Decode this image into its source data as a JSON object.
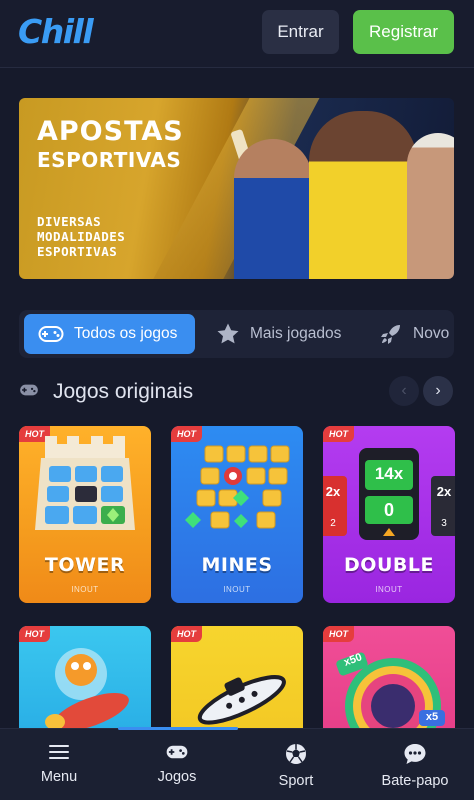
{
  "header": {
    "logo": "Chill",
    "login_label": "Entrar",
    "register_label": "Registrar"
  },
  "banner": {
    "title_line1": "APOSTAS",
    "title_line2": "ESPORTIVAS",
    "subtitle": "DIVERSAS MODALIDADES ESPORTIVAS"
  },
  "tabs": [
    {
      "label": "Todos os jogos",
      "icon": "gamepad-icon",
      "active": true
    },
    {
      "label": "Mais jogados",
      "icon": "star-icon",
      "active": false
    },
    {
      "label": "Novo",
      "icon": "rocket-icon",
      "active": false
    }
  ],
  "section": {
    "title": "Jogos originais",
    "icon": "gamepad-icon"
  },
  "games": [
    {
      "name": "TOWER",
      "provider": "INOUT",
      "badge": "HOT"
    },
    {
      "name": "MINES",
      "provider": "INOUT",
      "badge": "HOT"
    },
    {
      "name": "DOUBLE",
      "provider": "INOUT",
      "badge": "HOT"
    },
    {
      "name": "",
      "provider": "",
      "badge": "HOT"
    },
    {
      "name": "",
      "provider": "",
      "badge": "HOT"
    },
    {
      "name": "",
      "provider": "",
      "badge": "HOT"
    }
  ],
  "double_art": {
    "center": "14x",
    "center_value": "0",
    "left": "2x",
    "left_value": "2",
    "right": "2x",
    "right_value": "3"
  },
  "card6_art": {
    "top": "x50",
    "bottom": "x5"
  },
  "bottom_nav": [
    {
      "label": "Menu",
      "icon": "menu-icon"
    },
    {
      "label": "Jogos",
      "icon": "gamepad-icon"
    },
    {
      "label": "Sport",
      "icon": "soccer-ball-icon"
    },
    {
      "label": "Bate-papo",
      "icon": "chat-icon"
    }
  ],
  "colors": {
    "background": "#161a2b",
    "accent": "#3a8ef0",
    "register": "#5ac04a",
    "hot_badge": "#e53d3d"
  }
}
